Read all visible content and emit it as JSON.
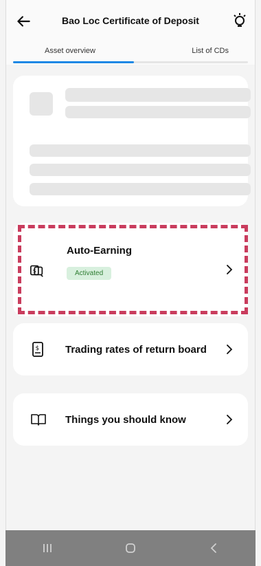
{
  "header": {
    "title": "Bao Loc Certificate of Deposit",
    "back_icon": "arrow-left-icon",
    "right_icon": "lightbulb-icon"
  },
  "tabs": [
    {
      "label": "Asset overview",
      "active": true
    },
    {
      "label": "List of CDs",
      "active": false
    }
  ],
  "auto_earning": {
    "title": "Auto-Earning",
    "badge": "Activated",
    "icon": "money-cards-icon"
  },
  "menu": [
    {
      "label": "Trading rates of return board",
      "icon": "document-dollar-icon"
    },
    {
      "label": "Things you should know",
      "icon": "open-book-icon"
    }
  ],
  "colors": {
    "accent": "#1e88e5",
    "badge_bg": "#d8f0de",
    "badge_text": "#2e7d32",
    "highlight": "#c93c5d"
  }
}
